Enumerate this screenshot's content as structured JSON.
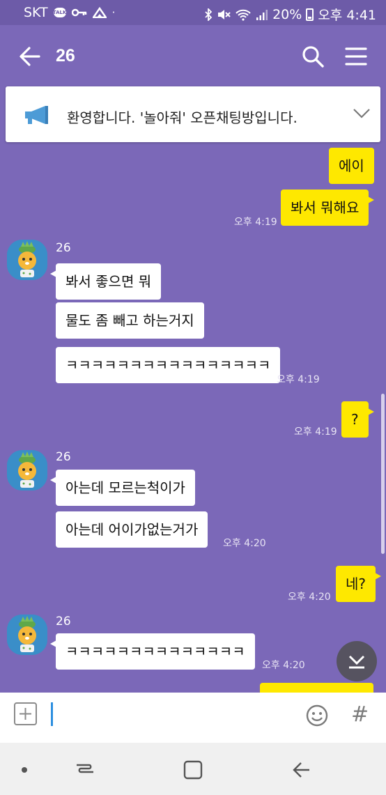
{
  "status_bar": {
    "carrier": "SKT",
    "talk_badge": "TALK",
    "battery": "20%",
    "time": "오후 4:41"
  },
  "header": {
    "title": "26"
  },
  "notice": {
    "text": "환영합니다. '놀아줘' 오픈채팅방입니다."
  },
  "messages": [
    {
      "from": "me",
      "text": "에이"
    },
    {
      "from": "me",
      "text": "봐서 뭐해요",
      "time": "오후 4:19"
    },
    {
      "from": "other",
      "sender": "26",
      "text": "봐서 좋으면 뭐"
    },
    {
      "from": "other",
      "text": "물도 좀 빼고 하는거지"
    },
    {
      "from": "other",
      "text": "ㅋㅋㅋㅋㅋㅋㅋㅋㅋㅋㅋㅋㅋㅋㅋㅋ",
      "time": "오후 4:19"
    },
    {
      "from": "me",
      "text": "?",
      "time": "오후 4:19"
    },
    {
      "from": "other",
      "sender": "26",
      "text": "아는데 모르는척이가"
    },
    {
      "from": "other",
      "text": "아는데 어이가없는거가",
      "time": "오후 4:20"
    },
    {
      "from": "me",
      "text": "네?",
      "time": "오후 4:20"
    },
    {
      "from": "other",
      "sender": "26",
      "text": "ㅋㅋㅋㅋㅋㅋㅋㅋㅋㅋㅋㅋㅋㅋ",
      "time": "오후 4:20"
    }
  ],
  "icons": {
    "back": "arrow-left-icon",
    "search": "search-icon",
    "menu": "hamburger-menu-icon",
    "notice": "megaphone-icon",
    "expand": "chevron-down-icon",
    "scroll_down": "scroll-to-bottom-icon",
    "attach": "plus-square-icon",
    "emoticon": "smiley-icon",
    "hashtag": "hash-icon"
  },
  "input": {
    "hash_symbol": "#"
  },
  "colors": {
    "chat_background": "#7b68b8",
    "my_bubble": "#fee800",
    "other_bubble": "#ffffff"
  }
}
